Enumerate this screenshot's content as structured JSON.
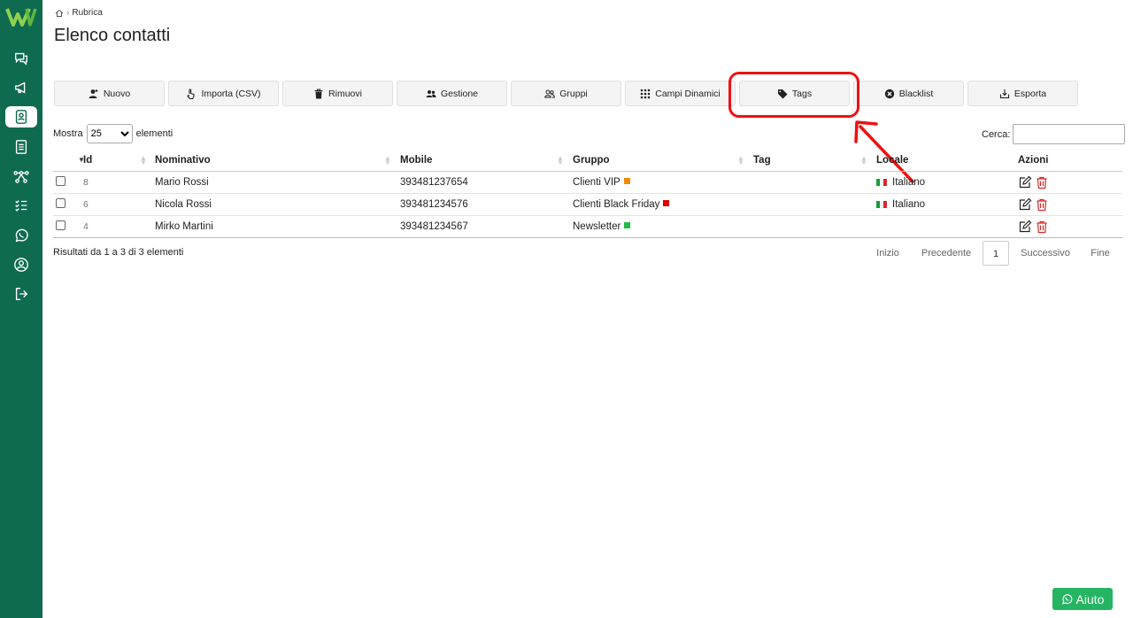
{
  "breadcrumb": {
    "current": "Rubrica"
  },
  "page_title": "Elenco contatti",
  "toolbar": [
    {
      "label": "Nuovo",
      "icon": "user-plus-icon"
    },
    {
      "label": "Importa (CSV)",
      "icon": "hand-pointer-icon"
    },
    {
      "label": "Rimuovi",
      "icon": "trash-icon"
    },
    {
      "label": "Gestione",
      "icon": "users-icon"
    },
    {
      "label": "Gruppi",
      "icon": "group-icon"
    },
    {
      "label": "Campi Dinamici",
      "icon": "grid-icon"
    },
    {
      "label": "Tags",
      "icon": "tag-icon"
    },
    {
      "label": "Blacklist",
      "icon": "block-icon"
    },
    {
      "label": "Esporta",
      "icon": "export-icon"
    }
  ],
  "length": {
    "prefix": "Mostra",
    "value": "25",
    "suffix": "elementi",
    "options": [
      "25"
    ]
  },
  "search": {
    "label": "Cerca:",
    "value": ""
  },
  "table": {
    "headers": [
      "Id",
      "Nominativo",
      "Mobile",
      "Gruppo",
      "Tag",
      "Locale",
      "Azioni"
    ],
    "rows": [
      {
        "id": "8",
        "name": "Mario Rossi",
        "mobile": "393481237654",
        "group": "Clienti VIP",
        "group_color": "#f08a00",
        "tag": "",
        "locale": "Italiano"
      },
      {
        "id": "6",
        "name": "Nicola Rossi",
        "mobile": "393481234576",
        "group": "Clienti Black Friday",
        "group_color": "#e00000",
        "tag": "",
        "locale": "Italiano"
      },
      {
        "id": "4",
        "name": "Mirko Martini",
        "mobile": "393481234567",
        "group": "Newsletter",
        "group_color": "#22bb44",
        "tag": "",
        "locale": ""
      }
    ]
  },
  "info": "Risultati da 1 a 3 di 3 elementi",
  "pagination": {
    "first": "Inizio",
    "prev": "Precedente",
    "current": "1",
    "next": "Successivo",
    "last": "Fine"
  },
  "help_button": "Aiuto",
  "colors": {
    "sidebar": "#0f6b50",
    "highlight": "#e11111",
    "help": "#25b562"
  }
}
